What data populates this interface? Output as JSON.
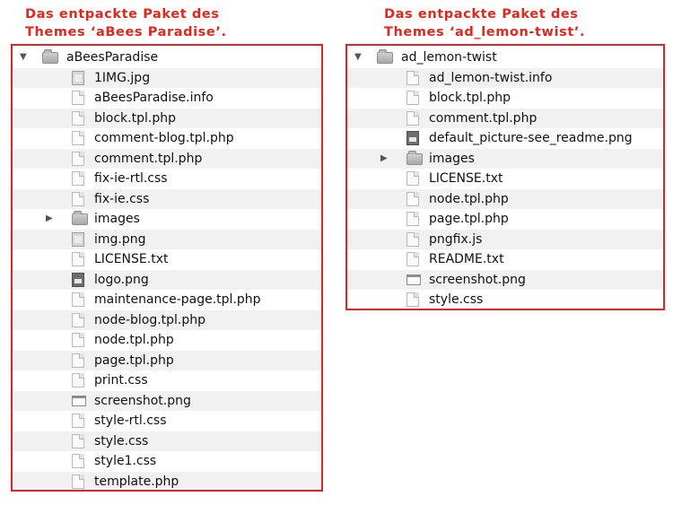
{
  "captions": {
    "left_line1": "Das entpackte Paket des",
    "left_line2": "Themes ‘aBees Paradise’.",
    "right_line1": "Das entpackte Paket des",
    "right_line2": "Themes ‘ad_lemon-twist’."
  },
  "left_tree": {
    "root": "aBeesParadise",
    "root_expanded": true,
    "items": [
      {
        "label": "1IMG.jpg",
        "icon": "image-file-icon"
      },
      {
        "label": "aBeesParadise.info",
        "icon": "document-icon"
      },
      {
        "label": "block.tpl.php",
        "icon": "document-icon"
      },
      {
        "label": "comment-blog.tpl.php",
        "icon": "document-icon"
      },
      {
        "label": "comment.tpl.php",
        "icon": "document-icon"
      },
      {
        "label": "fix-ie-rtl.css",
        "icon": "document-icon"
      },
      {
        "label": "fix-ie.css",
        "icon": "document-icon"
      },
      {
        "label": "images",
        "icon": "folder-icon",
        "collapsed": true
      },
      {
        "label": "img.png",
        "icon": "image-file-icon"
      },
      {
        "label": "LICENSE.txt",
        "icon": "document-icon"
      },
      {
        "label": "logo.png",
        "icon": "dark-image-file-icon"
      },
      {
        "label": "maintenance-page.tpl.php",
        "icon": "document-icon"
      },
      {
        "label": "node-blog.tpl.php",
        "icon": "document-icon"
      },
      {
        "label": "node.tpl.php",
        "icon": "document-icon"
      },
      {
        "label": "page.tpl.php",
        "icon": "document-icon"
      },
      {
        "label": "print.css",
        "icon": "document-icon"
      },
      {
        "label": "screenshot.png",
        "icon": "screenshot-file-icon"
      },
      {
        "label": "style-rtl.css",
        "icon": "document-icon"
      },
      {
        "label": "style.css",
        "icon": "document-icon"
      },
      {
        "label": "style1.css",
        "icon": "document-icon"
      },
      {
        "label": "template.php",
        "icon": "document-icon"
      }
    ]
  },
  "right_tree": {
    "root": "ad_lemon-twist",
    "root_expanded": true,
    "items": [
      {
        "label": "ad_lemon-twist.info",
        "icon": "document-icon"
      },
      {
        "label": "block.tpl.php",
        "icon": "document-icon"
      },
      {
        "label": "comment.tpl.php",
        "icon": "document-icon"
      },
      {
        "label": "default_picture-see_readme.png",
        "icon": "dark-image-file-icon"
      },
      {
        "label": "images",
        "icon": "folder-icon",
        "collapsed": true
      },
      {
        "label": "LICENSE.txt",
        "icon": "document-icon"
      },
      {
        "label": "node.tpl.php",
        "icon": "document-icon"
      },
      {
        "label": "page.tpl.php",
        "icon": "document-icon"
      },
      {
        "label": "pngfix.js",
        "icon": "document-icon"
      },
      {
        "label": "README.txt",
        "icon": "document-icon"
      },
      {
        "label": "screenshot.png",
        "icon": "screenshot-file-icon"
      },
      {
        "label": "style.css",
        "icon": "document-icon"
      }
    ]
  },
  "colors": {
    "caption": "#e0281e",
    "frame": "#d9262b",
    "stripe": "#f1f1f1"
  }
}
